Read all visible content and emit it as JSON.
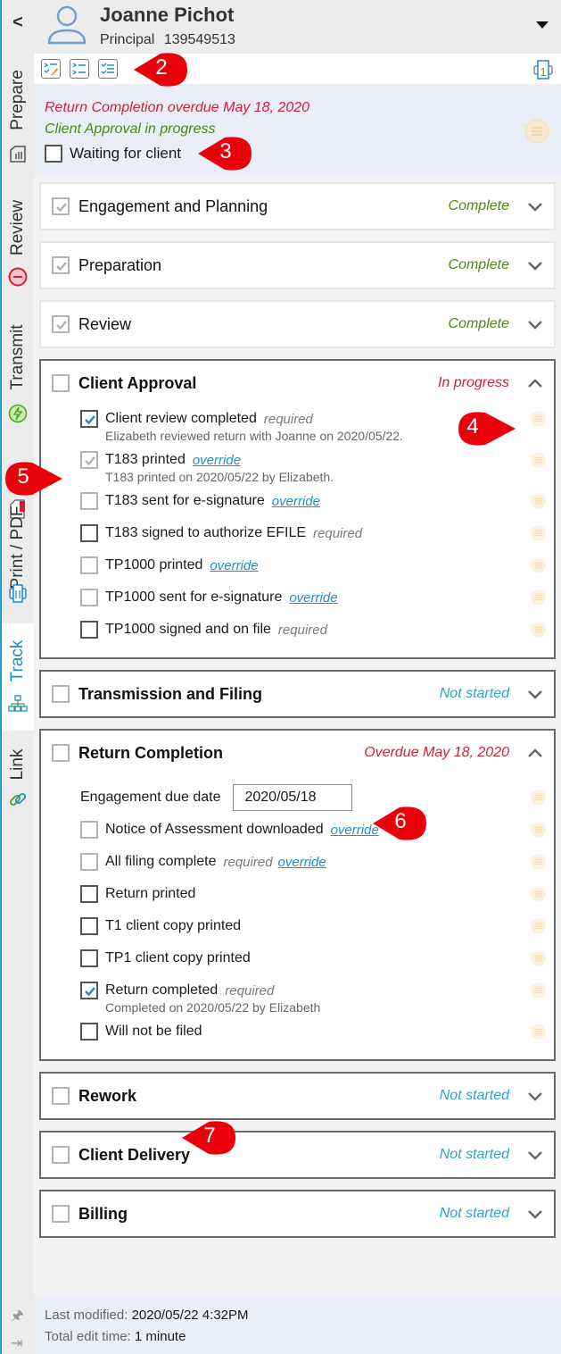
{
  "rail": {
    "back_label": "<",
    "tabs": [
      {
        "label": "Prepare",
        "icon": "checklist-icon"
      },
      {
        "label": "Review",
        "icon": "alert-circle-icon"
      },
      {
        "label": "Transmit",
        "icon": "lightning-icon"
      },
      {
        "label": "Print / PDF",
        "icon": "printer-icon"
      },
      {
        "label": "Track",
        "icon": "workflow-icon"
      },
      {
        "label": "Link",
        "icon": "link-icon"
      }
    ],
    "active_tab": "Track"
  },
  "header": {
    "name": "Joanne Pichot",
    "role": "Principal",
    "id": "139549513"
  },
  "toolbar": {
    "buttons": [
      "edit-checklist-icon",
      "list-icon",
      "checked-list-icon"
    ],
    "print_badge": "1"
  },
  "status": {
    "overdue_text": "Return Completion overdue May 18, 2020",
    "progress_text": "Client Approval in progress",
    "waiting_label": "Waiting for client",
    "waiting_checked": false
  },
  "sections": [
    {
      "title": "Engagement and Planning",
      "status": "Complete",
      "expanded": false
    },
    {
      "title": "Preparation",
      "status": "Complete",
      "expanded": false
    },
    {
      "title": "Review",
      "status": "Complete",
      "expanded": false
    },
    {
      "title": "Client Approval",
      "status": "In progress",
      "expanded": true,
      "items": [
        {
          "label": "Client review completed",
          "tag": "required",
          "note": "Elizabeth reviewed return with Joanne on 2020/05/22.",
          "checked": true
        },
        {
          "label": "T183 printed",
          "link": "override",
          "note": "T183 printed on 2020/05/22 by Elizabeth.",
          "checked": true
        },
        {
          "label": "T183 sent for e-signature",
          "link": "override",
          "checked": false
        },
        {
          "label": "T183 signed to authorize EFILE",
          "tag": "required",
          "checked": false
        },
        {
          "label": "TP1000 printed",
          "link": "override",
          "checked": false
        },
        {
          "label": "TP1000 sent for e-signature",
          "link": "override",
          "checked": false
        },
        {
          "label": "TP1000 signed and on file",
          "tag": "required",
          "checked": false
        }
      ]
    },
    {
      "title": "Transmission and Filing",
      "status": "Not started",
      "expanded": false
    },
    {
      "title": "Return Completion",
      "status": "Overdue May 18, 2020",
      "expanded": true,
      "due_label": "Engagement due date",
      "due_value": "2020/05/18",
      "items": [
        {
          "label": "Notice of Assessment downloaded",
          "link": "override",
          "checked": false
        },
        {
          "label": "All filing complete",
          "tag": "required",
          "link": "override",
          "checked": false
        },
        {
          "label": "Return printed",
          "checked": false
        },
        {
          "label": "T1 client copy printed",
          "checked": false
        },
        {
          "label": "TP1 client copy printed",
          "checked": false
        },
        {
          "label": "Return completed",
          "tag": "required",
          "note": "Completed on 2020/05/22 by Elizabeth",
          "checked": true
        },
        {
          "label": "Will not be filed",
          "checked": false
        }
      ]
    },
    {
      "title": "Rework",
      "status": "Not started",
      "expanded": false
    },
    {
      "title": "Client Delivery",
      "status": "Not started",
      "expanded": false
    },
    {
      "title": "Billing",
      "status": "Not started",
      "expanded": false
    }
  ],
  "footer": {
    "modified_label": "Last modified:",
    "modified_value": "2020/05/22 4:32PM",
    "edit_label": "Total edit time:",
    "edit_value": "1 minute"
  },
  "callouts": [
    "2",
    "3",
    "4",
    "5",
    "6",
    "7"
  ],
  "colors": {
    "accent": "#1a8fc7",
    "complete": "#4a8a12",
    "in_progress": "#d3203a",
    "not_started": "#2aa0d4",
    "callout": "#e8000b"
  }
}
